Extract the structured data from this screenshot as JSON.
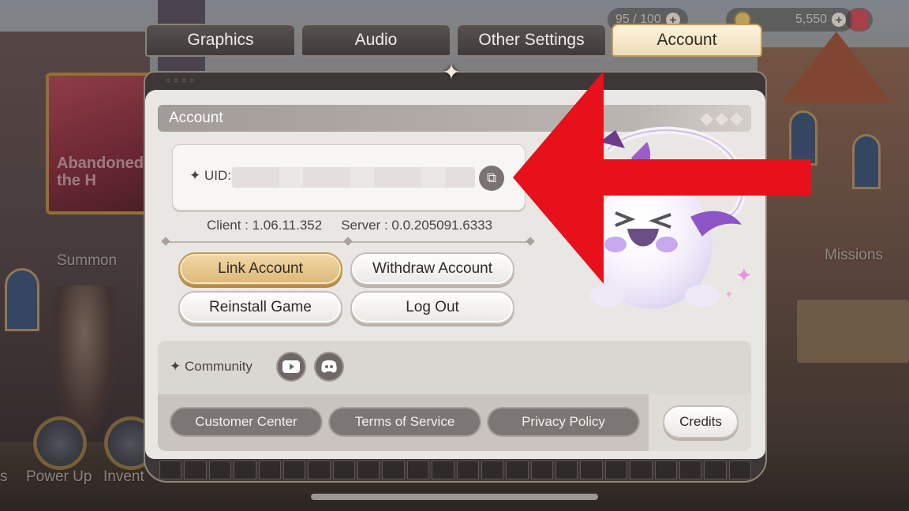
{
  "background": {
    "poster_text": "Abandoned the H",
    "labels": {
      "summon": "Summon",
      "missions": "Missions",
      "power_up": "Power Up",
      "inventory": "Invent",
      "left_cut": "s"
    }
  },
  "hud": {
    "stamina": "95 / 100",
    "gold": "5,550"
  },
  "tabs": [
    {
      "label": "Graphics",
      "active": false
    },
    {
      "label": "Audio",
      "active": false
    },
    {
      "label": "Other Settings",
      "active": false
    },
    {
      "label": "Account",
      "active": true
    }
  ],
  "account": {
    "section_title": "Account",
    "uid_label": "✦ UID:",
    "client_version": "Client : 1.06.11.352",
    "server_version": "Server : 0.0.205091.6333",
    "buttons": {
      "link_account": "Link Account",
      "withdraw_account": "Withdraw Account",
      "reinstall_game": "Reinstall Game",
      "log_out": "Log Out"
    }
  },
  "community": {
    "label": "✦  Community",
    "icons": [
      "youtube-icon",
      "discord-icon"
    ]
  },
  "footer": {
    "customer_center": "Customer Center",
    "terms_of_service": "Terms of Service",
    "privacy_policy": "Privacy Policy",
    "credits": "Credits"
  },
  "colors": {
    "accent_gold": "#dcb879",
    "annotation_red": "#e8101a",
    "panel_bg": "#e9e7e4"
  }
}
